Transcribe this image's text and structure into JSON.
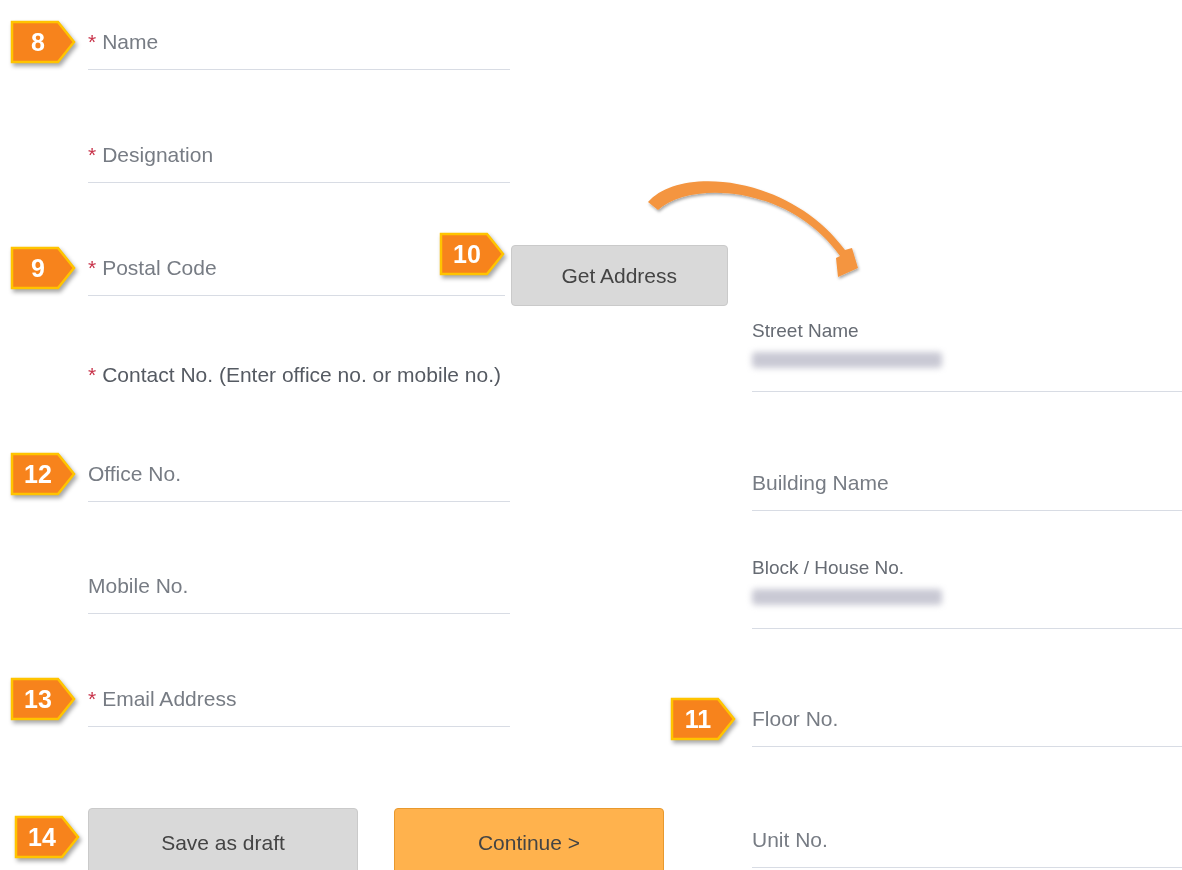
{
  "left_form": [
    {
      "kind": "field",
      "required_mark": "*",
      "placeholder": "Name",
      "callout": "8"
    },
    {
      "kind": "field",
      "required_mark": "*",
      "placeholder": "Designation"
    },
    {
      "kind": "field",
      "required_mark": "*",
      "placeholder": "Postal Code",
      "callout": "9",
      "button": {
        "label": "Get Address",
        "callout": "10"
      }
    },
    {
      "kind": "note",
      "required_mark": "*",
      "text": "Contact No. (Enter office no. or mobile no.)"
    },
    {
      "kind": "field",
      "placeholder": "Office No.",
      "callout": "12"
    },
    {
      "kind": "field",
      "placeholder": "Mobile No."
    },
    {
      "kind": "field",
      "required_mark": "*",
      "placeholder": "Email Address",
      "callout": "13"
    }
  ],
  "actions": {
    "callout": "14",
    "buttons": [
      {
        "label": "Save as draft",
        "kind": "secondary"
      },
      {
        "label": "Continue >",
        "kind": "primary"
      }
    ]
  },
  "address_fields": [
    {
      "label": "Street Name",
      "value_blurred": true
    },
    {
      "placeholder": "Building Name"
    },
    {
      "label": "Block / House No.",
      "value_blurred": true
    },
    {
      "placeholder": "Floor No.",
      "callout": "11"
    },
    {
      "placeholder": "Unit No."
    }
  ]
}
